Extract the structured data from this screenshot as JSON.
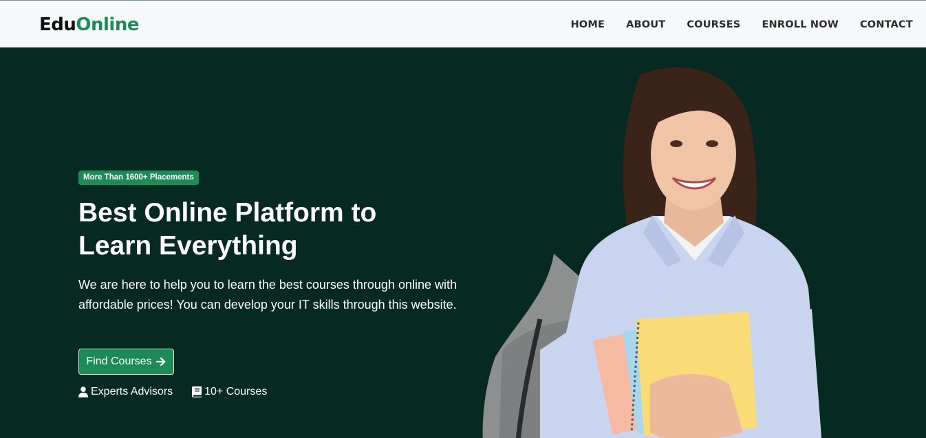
{
  "brand": {
    "part1": "Edu",
    "part2": "Online"
  },
  "nav": {
    "items": [
      "HOME",
      "ABOUT",
      "COURSES",
      "ENROLL NOW",
      "CONTACT"
    ]
  },
  "hero": {
    "badge": "More Than 1600+ Placements",
    "title_line1": "Best Online Platform to",
    "title_line2": "Learn Everything",
    "description": "We are here to help you to learn the best courses through online with affordable prices! You can develop your IT skills through this website.",
    "cta_label": "Find Courses",
    "cta_icon": "arrow-right-icon",
    "features": [
      {
        "icon": "user-icon",
        "label": "Experts Advisors"
      },
      {
        "icon": "book-icon",
        "label": "10+ Courses"
      }
    ]
  },
  "colors": {
    "topbar_bg": "#f8f9fa",
    "hero_bg": "#062a22",
    "accent": "#1d8a57",
    "text_dark": "#2b2b2b"
  }
}
